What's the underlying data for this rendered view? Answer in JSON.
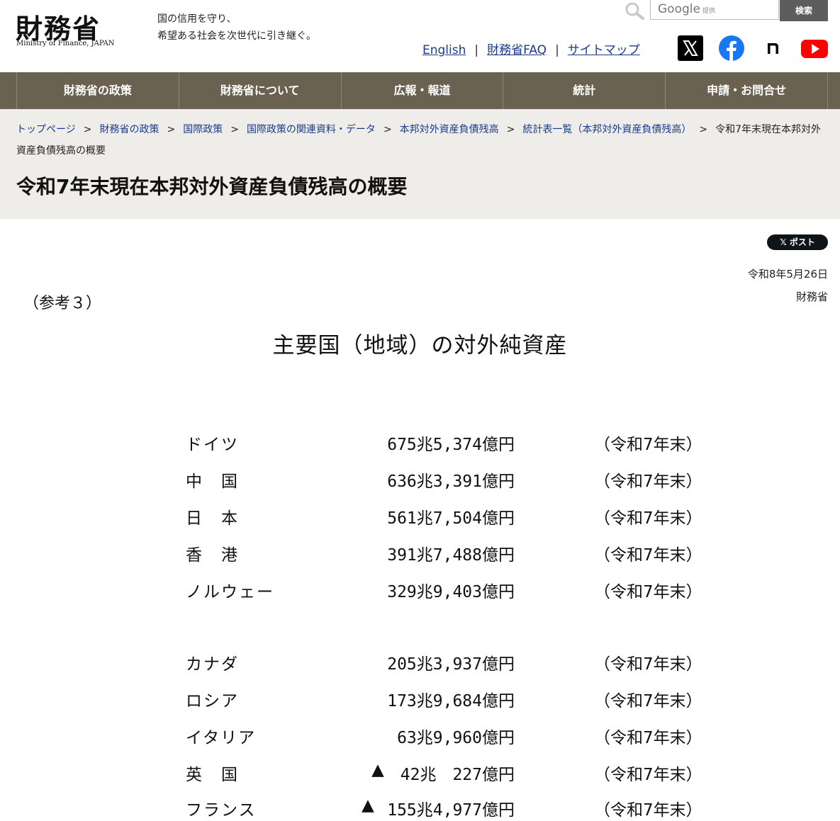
{
  "header": {
    "logo_kanji": "財務省",
    "logo_en": "Ministry of Finance, JAPAN",
    "tagline_1": "国の信用を守り、",
    "tagline_2": "希望ある社会を次世代に引き継ぐ。",
    "search_brand": "Google",
    "search_sub": "提供",
    "search_button": "検索",
    "links": [
      "English",
      "財務省FAQ",
      "サイトマップ"
    ],
    "link_separator": "|",
    "sns": [
      "x-icon",
      "facebook-icon",
      "note-icon",
      "youtube-icon"
    ]
  },
  "nav": {
    "items": [
      "財務省の政策",
      "財務省について",
      "広報・報道",
      "統計",
      "申請・お問合せ"
    ]
  },
  "breadcrumb": {
    "items": [
      "トップページ",
      "財務省の政策",
      "国際政策",
      "国際政策の関連資料・データ",
      "本邦対外資産負債残高",
      "統計表一覧（本邦対外資産負債残高）"
    ],
    "current": "令和7年末現在本邦対外資産負債残高の概要",
    "separator": ">"
  },
  "page_title": "令和7年末現在本邦対外資産負債残高の概要",
  "share_button": "ポスト",
  "date": "令和8年5月26日",
  "issuer": "財務省",
  "reference": "（参考３）",
  "doc_title": "主要国（地域）の対外純資産",
  "rows": [
    {
      "name": "ドイツ",
      "mark": "",
      "value": "675兆5,374億円",
      "when": "（令和7年末）"
    },
    {
      "name": "中　国",
      "mark": "",
      "value": "636兆3,391億円",
      "when": "（令和7年末）"
    },
    {
      "name": "日　本",
      "mark": "",
      "value": "561兆7,504億円",
      "when": "（令和7年末）"
    },
    {
      "name": "香　港",
      "mark": "",
      "value": "391兆7,488億円",
      "when": "（令和7年末）"
    },
    {
      "name": "ノルウェー",
      "mark": "",
      "value": "329兆9,403億円",
      "when": "（令和7年末）"
    },
    {
      "name": "カナダ",
      "mark": "",
      "value": "205兆3,937億円",
      "when": "（令和7年末）"
    },
    {
      "name": "ロシア",
      "mark": "",
      "value": "173兆9,684億円",
      "when": "（令和7年末）"
    },
    {
      "name": "イタリア",
      "mark": "",
      "value": "63兆9,960億円",
      "when": "（令和7年末）"
    },
    {
      "name": "英　国",
      "mark": "▲",
      "value": "42兆　227億円",
      "when": "（令和7年末）"
    },
    {
      "name": "フランス",
      "mark": "▲",
      "value": "155兆4,977億円",
      "when": "（令和7年末）"
    }
  ]
}
